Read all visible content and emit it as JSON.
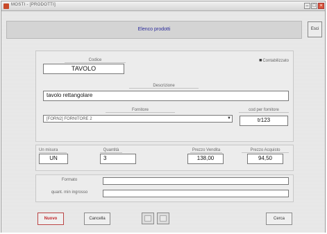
{
  "window": {
    "title": "MOSTI - [PRODOTTI]",
    "minimize": "–",
    "maximize": "□",
    "close": "×"
  },
  "header": {
    "title": "Elenco prodotti",
    "esci_label": "Esci"
  },
  "product": {
    "codice_label": "Codice",
    "codice_value": "TAVOLO",
    "contabilizzato_label": "Contabilizzato",
    "contabilizzato_checked": true,
    "descrizione_label": "Descrizione",
    "descrizione_value": "tavolo rettangolare",
    "fornitore_label": "Fornitore",
    "fornitore_value": "[FORN2]  FORNITORE 2",
    "cod_fornitore_label": "cod per fornitore",
    "cod_fornitore_value": "tr123"
  },
  "quantities": {
    "um_label": "Un misura",
    "um_value": "UN",
    "quantita_label": "Quantità",
    "quantita_value": "3",
    "prezzo_vendita_label": "Prezzo Vendita",
    "prezzo_vendita_value": "138,00",
    "prezzo_acquisto_label": "Prezzo Acquisto",
    "prezzo_acquisto_value": "94,50"
  },
  "extra": {
    "formato_label": "Formato",
    "formato_value": "",
    "quant_min_label": "quant. min ingrosso",
    "quant_min_value": ""
  },
  "toolbar": {
    "nuovo_label": "Nuovo",
    "cancella_label": "Cancella",
    "cerca_label": "Cerca"
  },
  "icons": {
    "app": "app-icon",
    "prev": "prev-record-icon",
    "next": "next-record-icon",
    "dropdown": "chevron-down-icon",
    "checkbox": "checkbox-icon"
  }
}
